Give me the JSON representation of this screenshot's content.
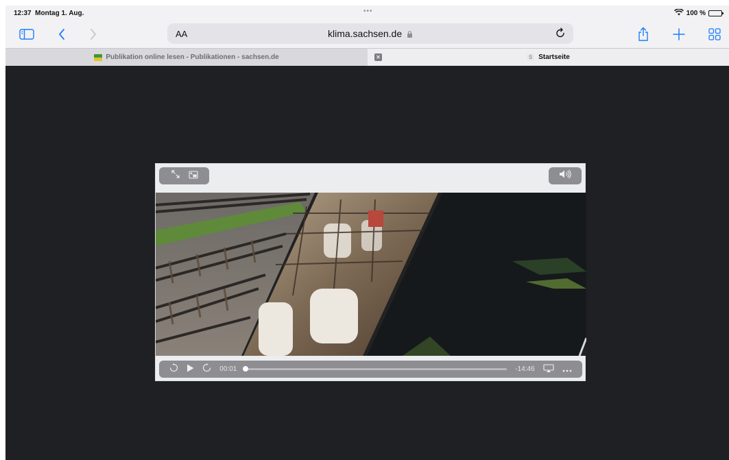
{
  "status": {
    "time": "12:37",
    "date": "Montag 1. Aug.",
    "center_dots": "•••",
    "battery_percent": "100 %",
    "battery_level": 1.0
  },
  "toolbar": {
    "icons": [
      "sidebar-icon",
      "back-icon",
      "forward-icon",
      "share-icon",
      "plus-icon",
      "tabs-overview-icon"
    ],
    "text_size_label": "AA",
    "url": "klima.sachsen.de",
    "accent": "#1a7cff"
  },
  "tabs": [
    {
      "label": "Publikation online lesen - Publikationen - sachsen.de",
      "close_glyph": "✕",
      "active": false
    },
    {
      "label": "Startseite",
      "favicon_letter": "S",
      "active": true
    }
  ],
  "player": {
    "current_time": "00:01",
    "remaining_time": "-14:46",
    "progress": 0.0,
    "controls": [
      "fullscreen-icon",
      "picture-in-picture-icon",
      "volume-icon",
      "skip-back-15-icon",
      "play-icon",
      "skip-forward-15-icon",
      "airplay-icon",
      "more-icon"
    ]
  }
}
